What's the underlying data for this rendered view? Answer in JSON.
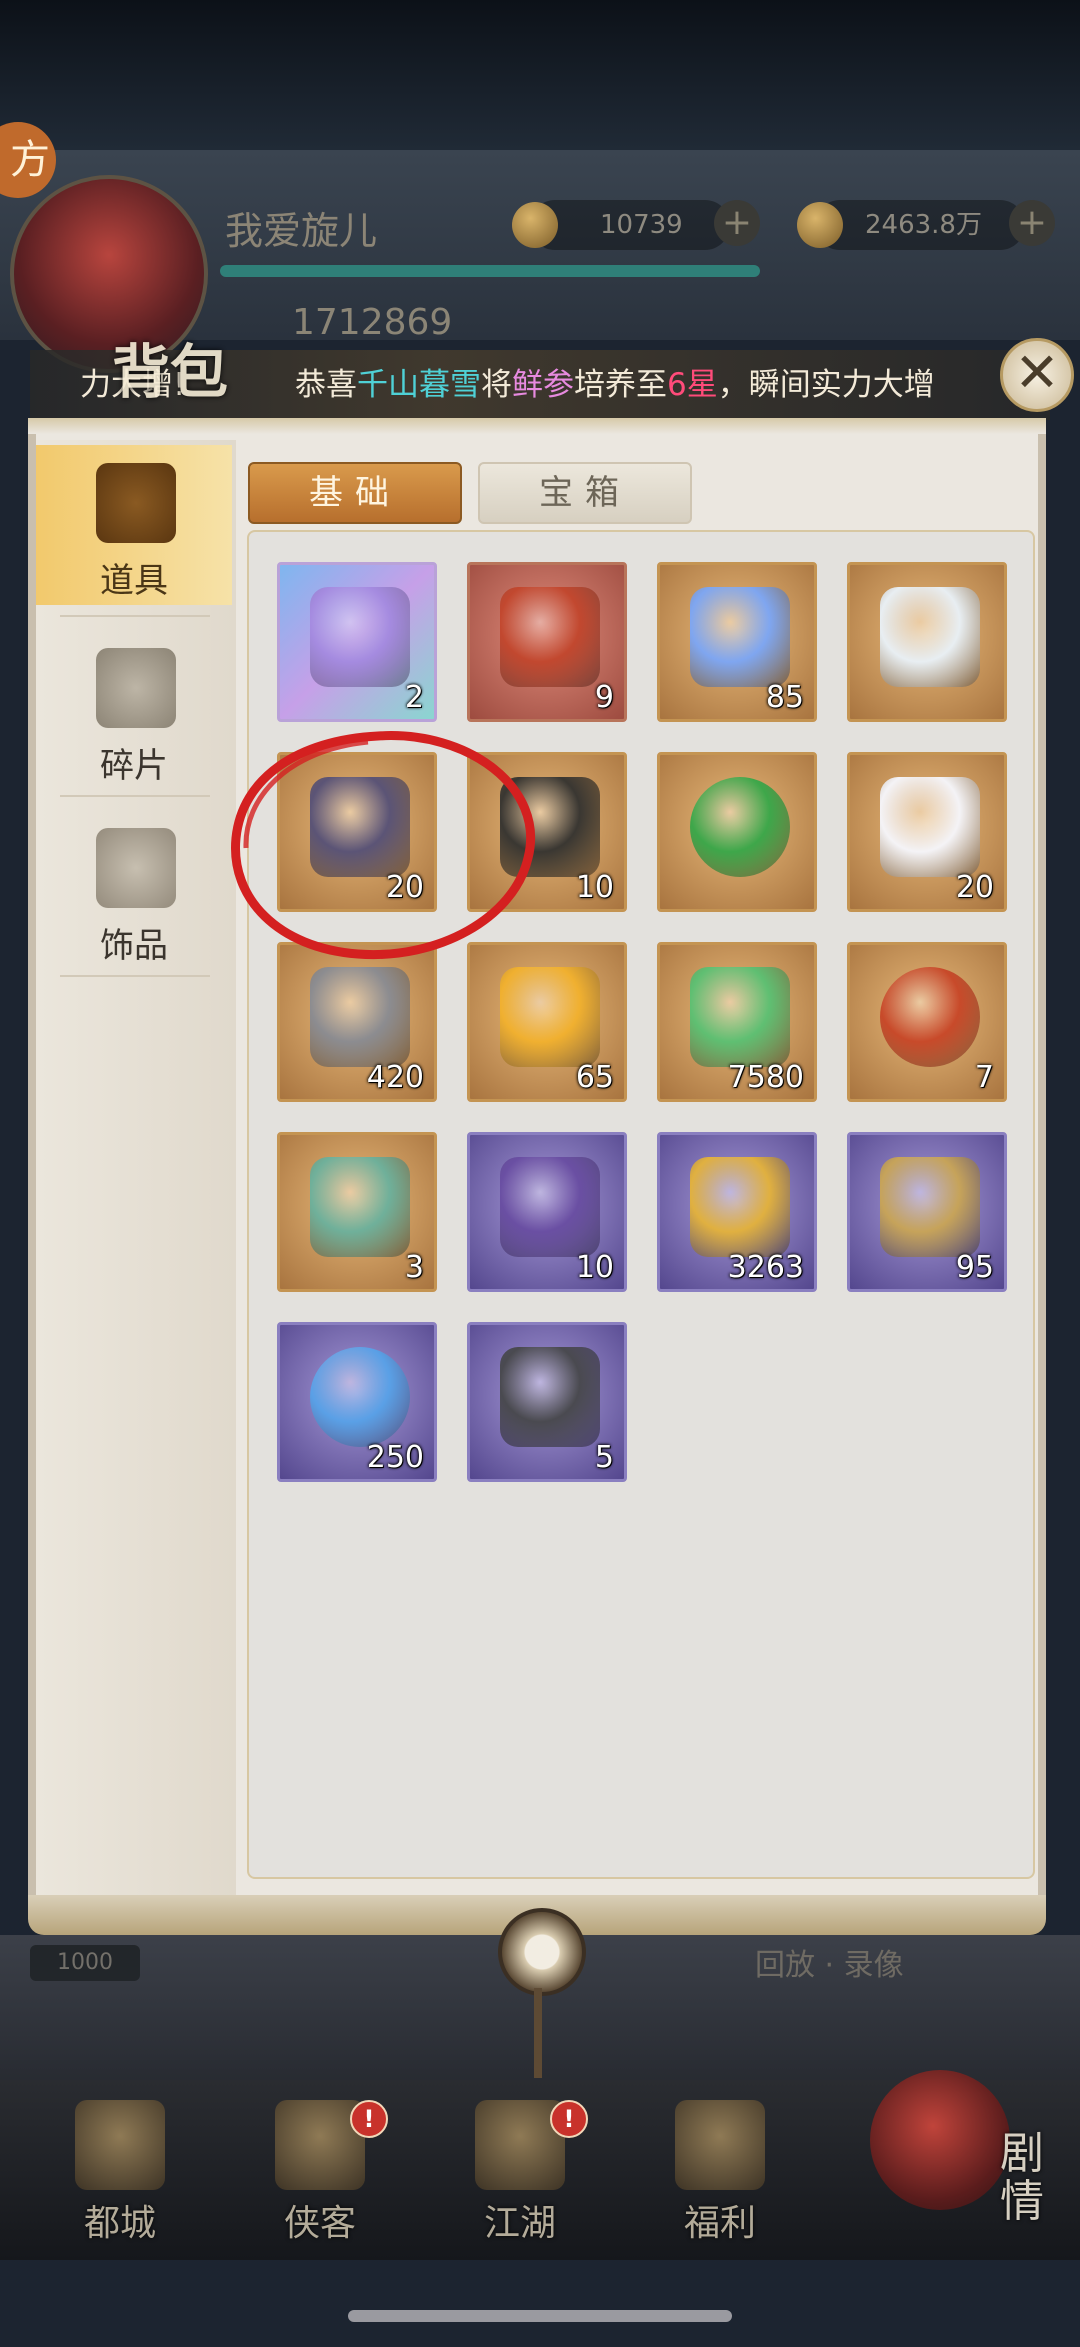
{
  "hud": {
    "role_tab": "方",
    "player_name": "我爱旋儿",
    "gold_amount": "10739",
    "silver_amount": "2463.8万",
    "plus_symbol": "+",
    "power_value": "1712869"
  },
  "announcement": {
    "prefix": "力大增!",
    "parts": [
      "恭喜",
      "千山暮雪",
      "将",
      "鲜参",
      "培养至",
      "6星",
      "，瞬间实力大增"
    ]
  },
  "panel": {
    "title": "背包",
    "close_symbol": "✕",
    "sidebar": [
      {
        "label": "道具",
        "active": true,
        "icon": "item-chest-icon"
      },
      {
        "label": "碎片",
        "active": false,
        "icon": "fragment-hat-icon"
      },
      {
        "label": "饰品",
        "active": false,
        "icon": "accessory-robe-icon"
      }
    ],
    "tabs": [
      {
        "label": "基础",
        "active": true
      },
      {
        "label": "宝箱",
        "active": false
      }
    ],
    "items": [
      {
        "name": "rainbow-dragon-token",
        "quality": "rainbow",
        "qty": "2",
        "color": "#a58be0"
      },
      {
        "name": "red-tag-token",
        "quality": "red",
        "qty": "9",
        "color": "#c2482f"
      },
      {
        "name": "crystal-shard",
        "quality": "gold",
        "qty": "85",
        "color": "#7fa6f0"
      },
      {
        "name": "silver-star",
        "quality": "gold",
        "qty": "",
        "color": "#e8eef2"
      },
      {
        "name": "scroll-tube",
        "quality": "gold",
        "qty": "20",
        "color": "#5b5476"
      },
      {
        "name": "dark-ore",
        "quality": "gold",
        "qty": "10",
        "color": "#3a3732"
      },
      {
        "name": "green-orb",
        "quality": "gold",
        "qty": "",
        "color": "#3ea74a"
      },
      {
        "name": "white-lotus",
        "quality": "gold",
        "qty": "20",
        "color": "#f4f3f6"
      },
      {
        "name": "twisted-rod",
        "quality": "gold",
        "qty": "420",
        "color": "#8c8c90"
      },
      {
        "name": "elixir-bottle",
        "quality": "gold",
        "qty": "65",
        "color": "#f0b030"
      },
      {
        "name": "jade-pendant",
        "quality": "gold",
        "qty": "7580",
        "color": "#5fbf72"
      },
      {
        "name": "red-orb",
        "quality": "gold",
        "qty": "7",
        "color": "#c84a2a"
      },
      {
        "name": "dragon-card",
        "quality": "gold",
        "qty": "3",
        "color": "#6fb09a"
      },
      {
        "name": "fortune-tag",
        "quality": "purple",
        "qty": "10",
        "color": "#6a4fa3"
      },
      {
        "name": "gold-pearl-cushion",
        "quality": "purple",
        "qty": "3263",
        "color": "#e0b040"
      },
      {
        "name": "order-token",
        "quality": "purple",
        "qty": "95",
        "color": "#c6a35a"
      },
      {
        "name": "blue-orb",
        "quality": "purple",
        "qty": "250",
        "color": "#5aa0e6"
      },
      {
        "name": "iron-ore",
        "quality": "purple",
        "qty": "5",
        "color": "#4a4a50"
      }
    ]
  },
  "background": {
    "hp_label": "1000",
    "record_label": "回放 · 录像"
  },
  "bottom_nav": [
    {
      "label": "都城",
      "badge": ""
    },
    {
      "label": "侠客",
      "badge": "!"
    },
    {
      "label": "江湖",
      "badge": "!"
    },
    {
      "label": "福利",
      "badge": ""
    }
  ],
  "story_button": "剧情"
}
